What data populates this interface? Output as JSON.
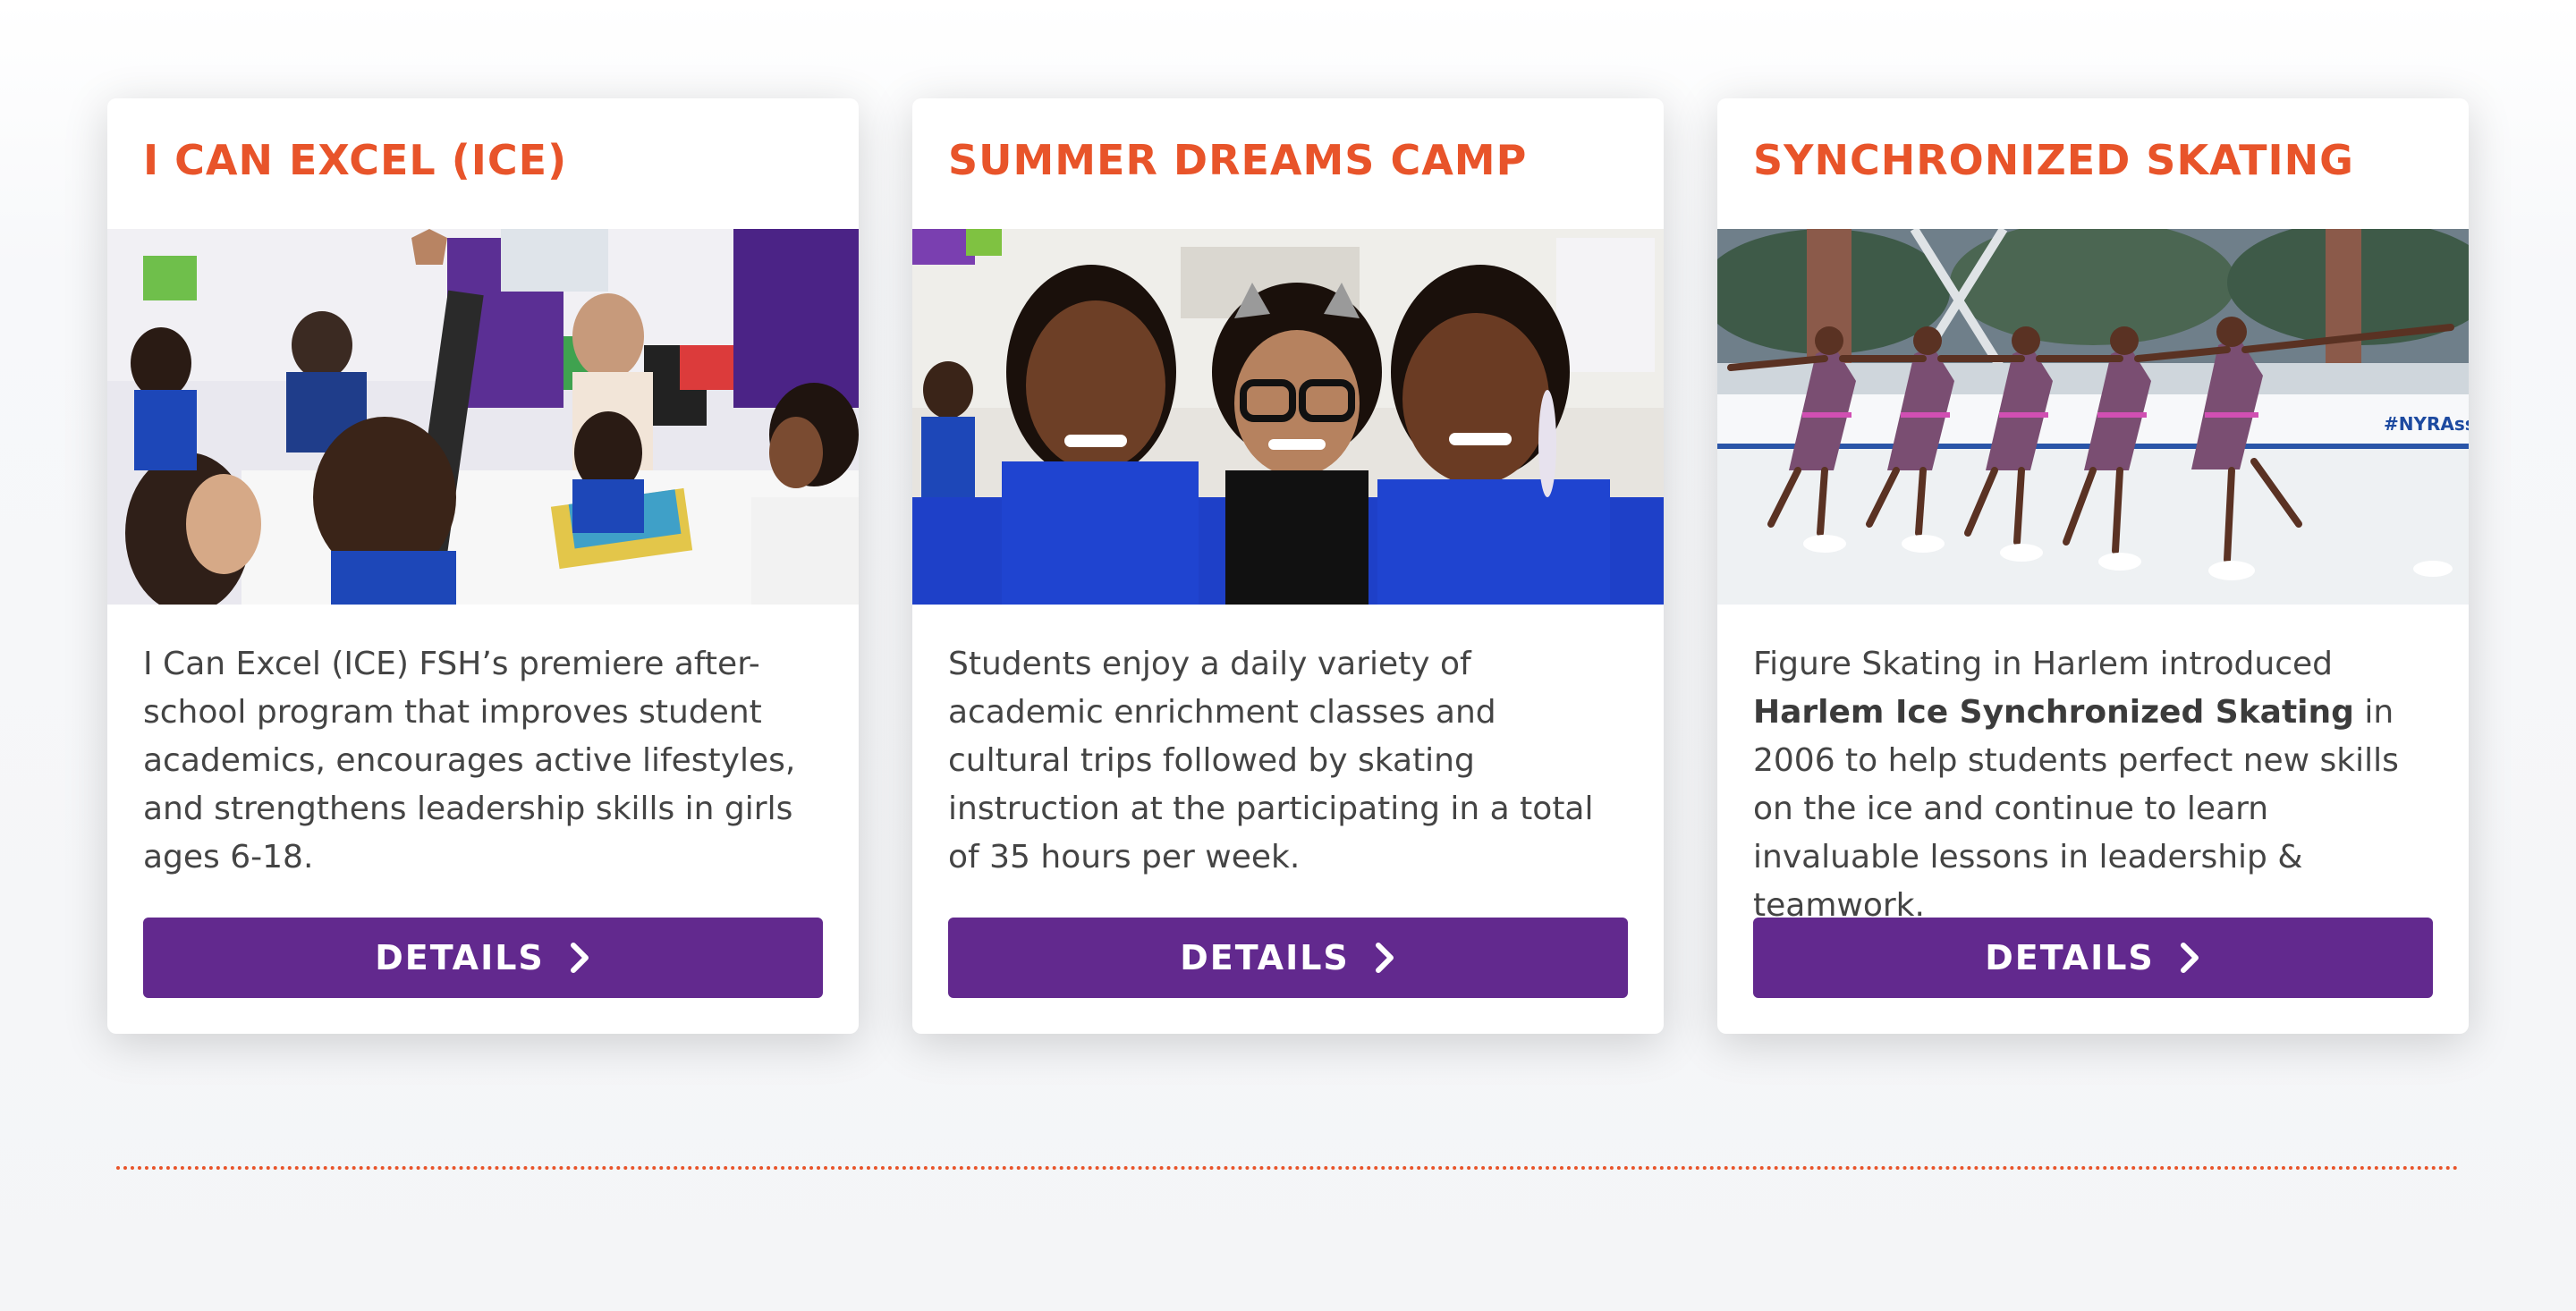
{
  "cards": [
    {
      "title": "I CAN EXCEL (ICE)",
      "text": "I Can Excel (ICE) FSH’s premiere after-school program that improves student academics, encourages active lifestyles, and strengthens leadership skills in girls ages 6-18.",
      "button": "DETAILS"
    },
    {
      "title": "SUMMER DREAMS CAMP",
      "text": "Students enjoy a daily variety of academic enrichment classes and cultural trips followed by skating instruction at the  participating in a total of 35 hours per week.",
      "button": "DETAILS"
    },
    {
      "title": "SYNCHRONIZED SKATING",
      "text_before": "Figure Skating in Harlem introduced ",
      "text_bold": "Harlem Ice Synchronized Skating",
      "text_after": " in 2006 to help students perfect new skills on the ice and continue to learn invaluable lessons in leadership & teamwork.",
      "rink_sign": "#NYRAssi",
      "button": "DETAILS"
    }
  ],
  "colors": {
    "title": "#e8542a",
    "button": "#62298e",
    "divider": "#e8542a",
    "text": "#444444"
  },
  "icons": {
    "button_icon": "chevron-right-icon"
  }
}
